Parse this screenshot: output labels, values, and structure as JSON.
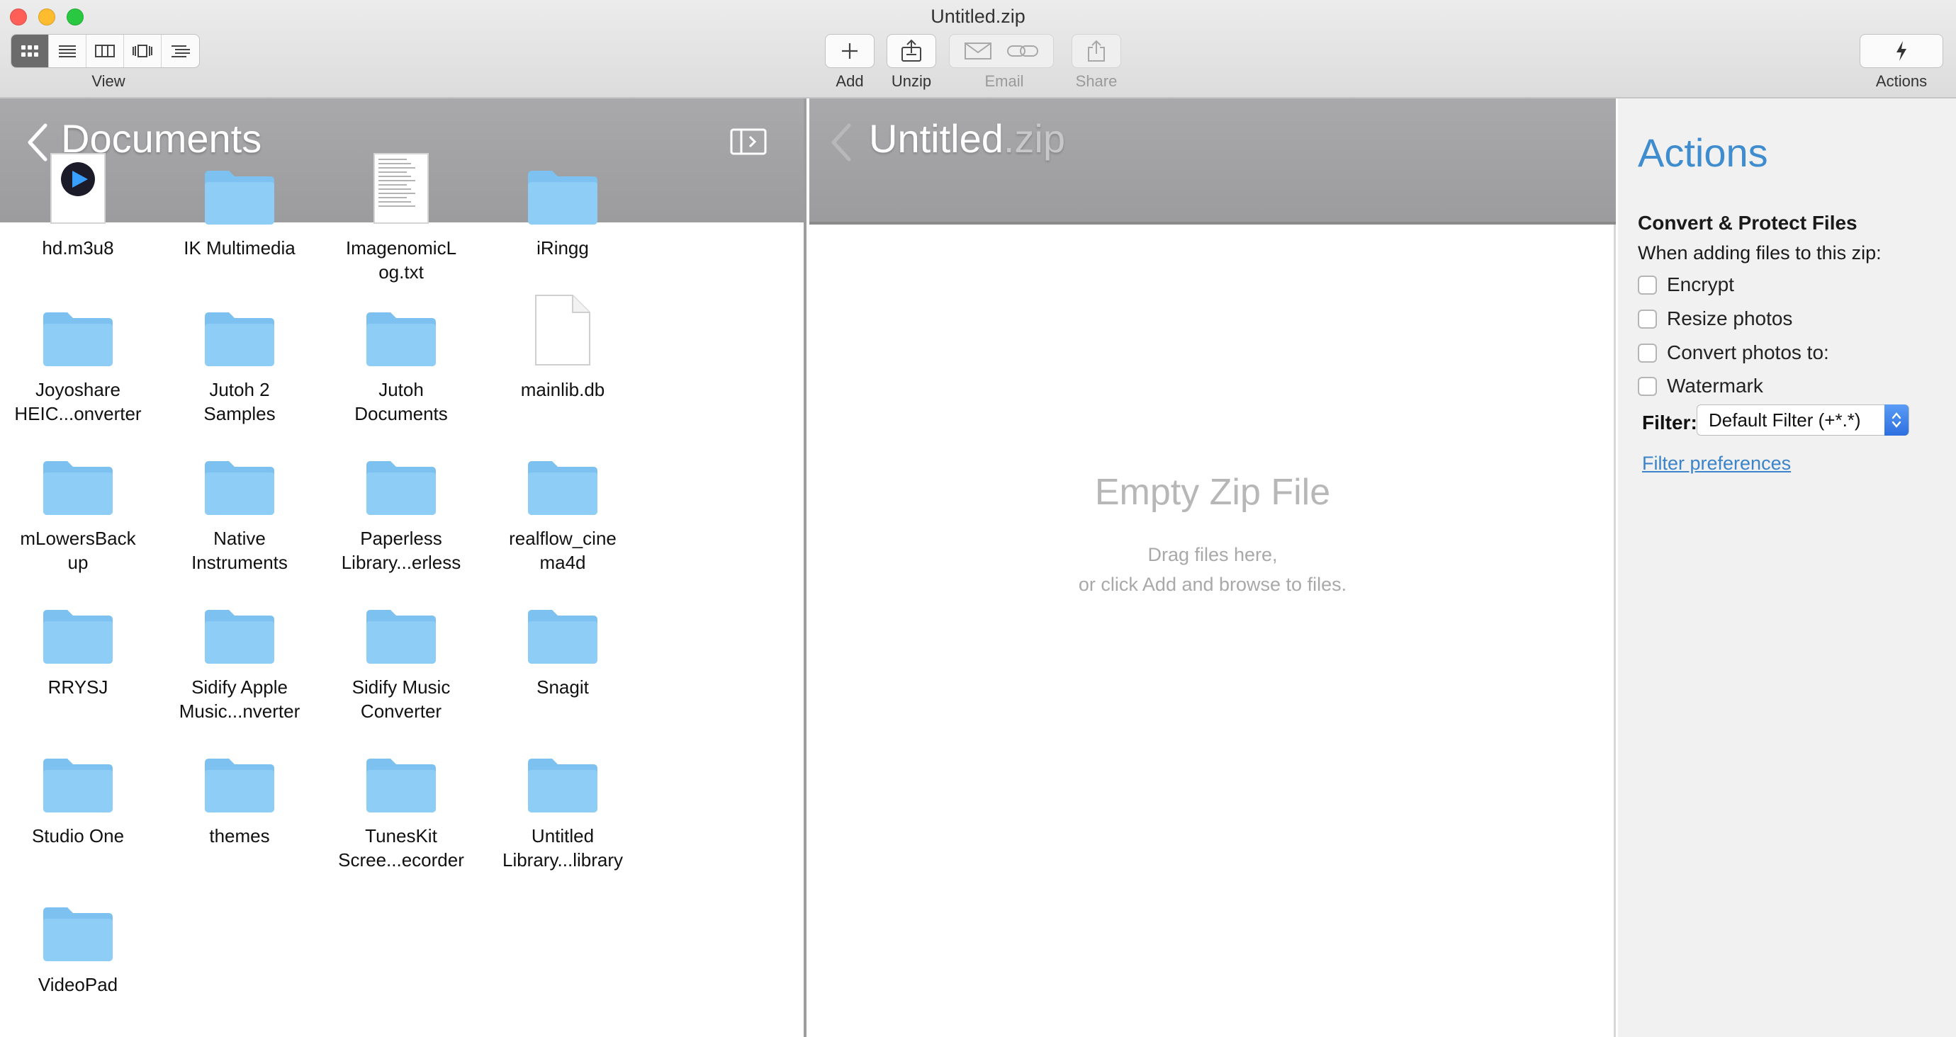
{
  "window": {
    "title": "Untitled.zip"
  },
  "toolbar": {
    "view_label": "View",
    "add_label": "Add",
    "unzip_label": "Unzip",
    "email_label": "Email",
    "share_label": "Share",
    "actions_label": "Actions",
    "view_modes": [
      "icon-grid",
      "list",
      "columns",
      "cover-flow",
      "outline"
    ]
  },
  "left_pane": {
    "title": "Documents",
    "files": [
      {
        "name": "hd.m3u8",
        "kind": "media"
      },
      {
        "name": "IK Multimedia",
        "kind": "folder"
      },
      {
        "name": "ImagenomicLog.txt",
        "kind": "text"
      },
      {
        "name": "iRingg",
        "kind": "folder"
      },
      {
        "name": "Joyoshare HEIC...onverter",
        "kind": "folder"
      },
      {
        "name": "Jutoh 2 Samples",
        "kind": "folder"
      },
      {
        "name": "Jutoh Documents",
        "kind": "folder"
      },
      {
        "name": "mainlib.db",
        "kind": "document"
      },
      {
        "name": "mLowersBackup",
        "kind": "folder"
      },
      {
        "name": "Native Instruments",
        "kind": "folder"
      },
      {
        "name": "Paperless Library...erless",
        "kind": "folder"
      },
      {
        "name": "realflow_cinema4d",
        "kind": "folder"
      },
      {
        "name": "RRYSJ",
        "kind": "folder"
      },
      {
        "name": "Sidify Apple Music...nverter",
        "kind": "folder"
      },
      {
        "name": "Sidify Music Converter",
        "kind": "folder"
      },
      {
        "name": "Snagit",
        "kind": "folder"
      },
      {
        "name": "Studio One",
        "kind": "folder"
      },
      {
        "name": "themes",
        "kind": "folder"
      },
      {
        "name": "TunesKit Scree...ecorder",
        "kind": "folder"
      },
      {
        "name": "Untitled Library...library",
        "kind": "folder"
      },
      {
        "name": "VideoPad",
        "kind": "folder"
      }
    ],
    "label_lines": [
      [
        "hd.m3u8"
      ],
      [
        "IK Multimedia"
      ],
      [
        "ImagenomicL",
        "og.txt"
      ],
      [
        "iRingg"
      ],
      [
        "Joyoshare",
        "HEIC...onverter"
      ],
      [
        "Jutoh 2",
        "Samples"
      ],
      [
        "Jutoh",
        "Documents"
      ],
      [
        "mainlib.db"
      ],
      [
        "mLowersBack",
        "up"
      ],
      [
        "Native",
        "Instruments"
      ],
      [
        "Paperless",
        "Library...erless"
      ],
      [
        "realflow_cine",
        "ma4d"
      ],
      [
        "RRYSJ"
      ],
      [
        "Sidify Apple",
        "Music...nverter"
      ],
      [
        "Sidify Music",
        "Converter"
      ],
      [
        "Snagit"
      ],
      [
        "Studio One"
      ],
      [
        "themes"
      ],
      [
        "TunesKit",
        "Scree...ecorder"
      ],
      [
        "Untitled",
        "Library...library"
      ],
      [
        "VideoPad"
      ]
    ]
  },
  "zip_pane": {
    "title_base": "Untitled",
    "title_ext": ".zip",
    "empty_title": "Empty Zip File",
    "empty_line1": "Drag files here,",
    "empty_line2": "or click Add and browse to files."
  },
  "actions_pane": {
    "title": "Actions",
    "section_title": "Convert & Protect Files",
    "section_subtitle": "When adding files to this zip:",
    "options": [
      {
        "label": "Encrypt",
        "checked": false
      },
      {
        "label": "Resize photos",
        "checked": false
      },
      {
        "label": "Convert photos to:",
        "checked": false
      },
      {
        "label": "Watermark",
        "checked": false
      }
    ],
    "filter_label": "Filter:",
    "filter_value": "Default Filter (+*.*)",
    "filter_link": "Filter preferences"
  },
  "colors": {
    "accent_blue": "#3f8ccf",
    "header_gray": "#a3a3a5",
    "folder_blue": "#8dcdf6"
  }
}
